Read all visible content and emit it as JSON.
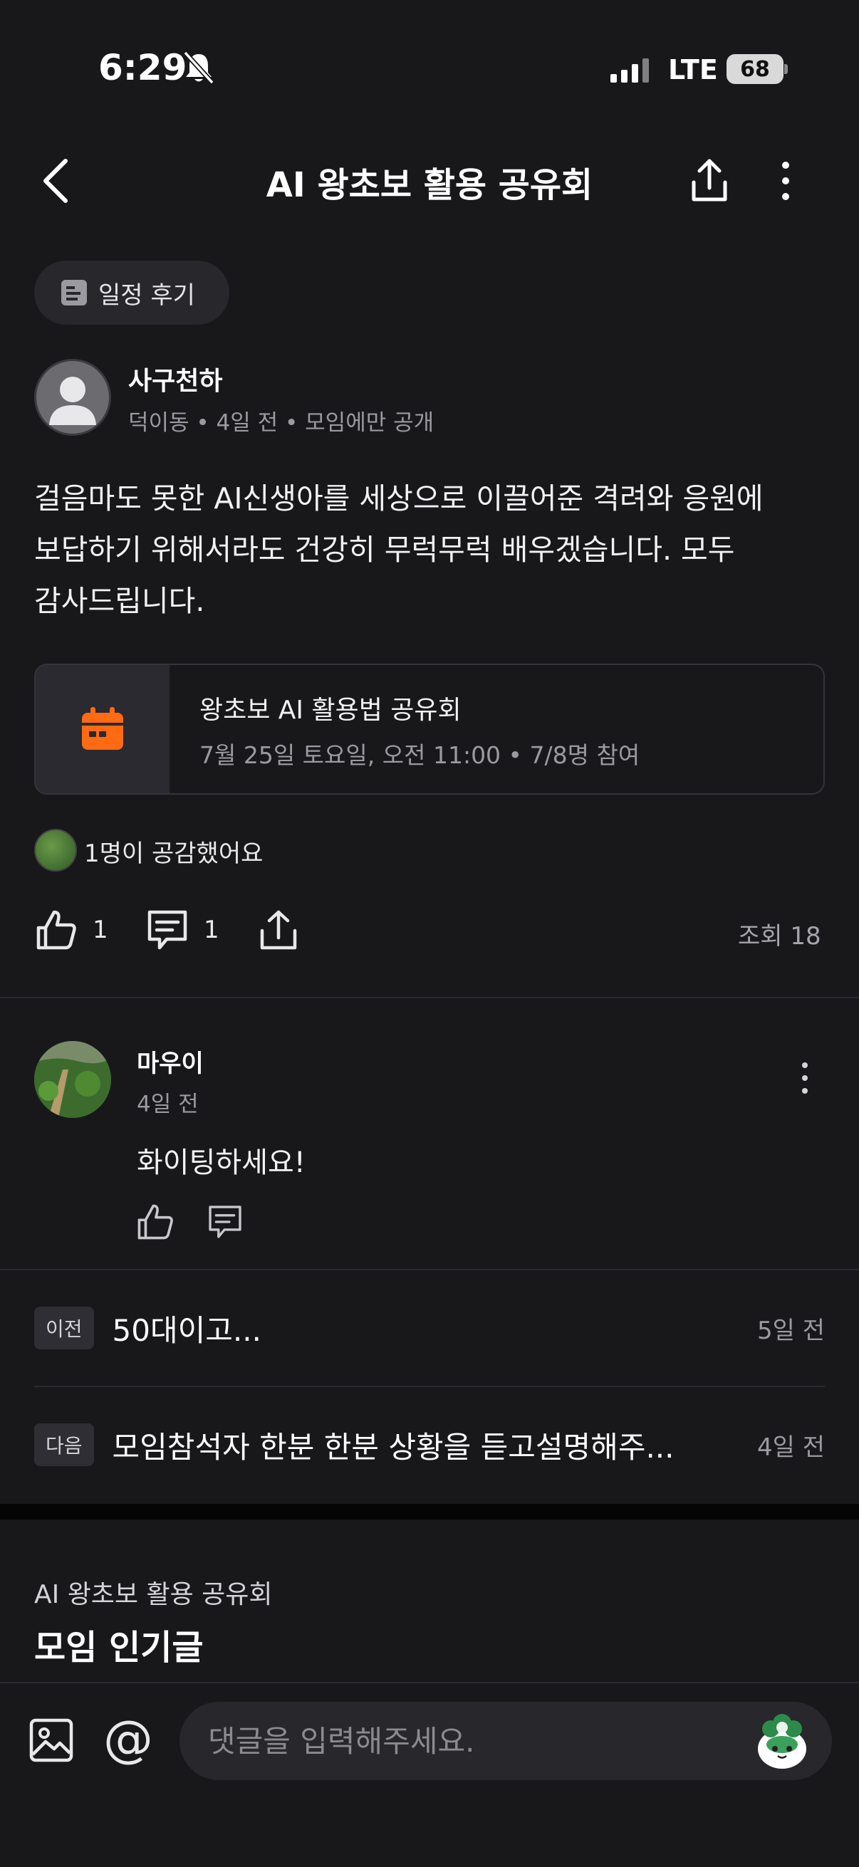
{
  "status": {
    "time": "6:29",
    "network": "LTE",
    "battery": "68"
  },
  "topbar": {
    "title": "AI 왕초보 활용 공유회"
  },
  "post": {
    "tag": "일정 후기",
    "author": "사구천하",
    "meta": "덕이동 • 4일 전 • 모임에만 공개",
    "body": "걸음마도 못한 AI신생아를 세상으로 이끌어준 격려와 응원에 보답하기 위해서라도 건강히 무럭무럭 배우겠습니다. 모두 감사드립니다.",
    "event": {
      "title": "왕초보 AI 활용법 공유회",
      "detail": "7월 25일 토요일, 오전 11:00 • 7/8명 참여"
    },
    "empathy": "1명이 공감했어요",
    "likes": "1",
    "comments": "1",
    "views": "조회 18"
  },
  "comment": {
    "author": "마우이",
    "time": "4일 전",
    "text": "화이팅하세요!"
  },
  "navigation": {
    "prev": {
      "chip": "이전",
      "title": "50대이고...",
      "time": "5일 전"
    },
    "next": {
      "chip": "다음",
      "title": "모임참석자 한분 한분 상황을 듣고설명해주...",
      "time": "4일 전"
    }
  },
  "group": {
    "name": "AI 왕초보 활용 공유회",
    "section": "모임 인기글"
  },
  "input": {
    "placeholder": "댓글을 입력해주세요.",
    "at": "@"
  },
  "colors": {
    "accent": "#ff6a13",
    "background": "#18181b"
  }
}
